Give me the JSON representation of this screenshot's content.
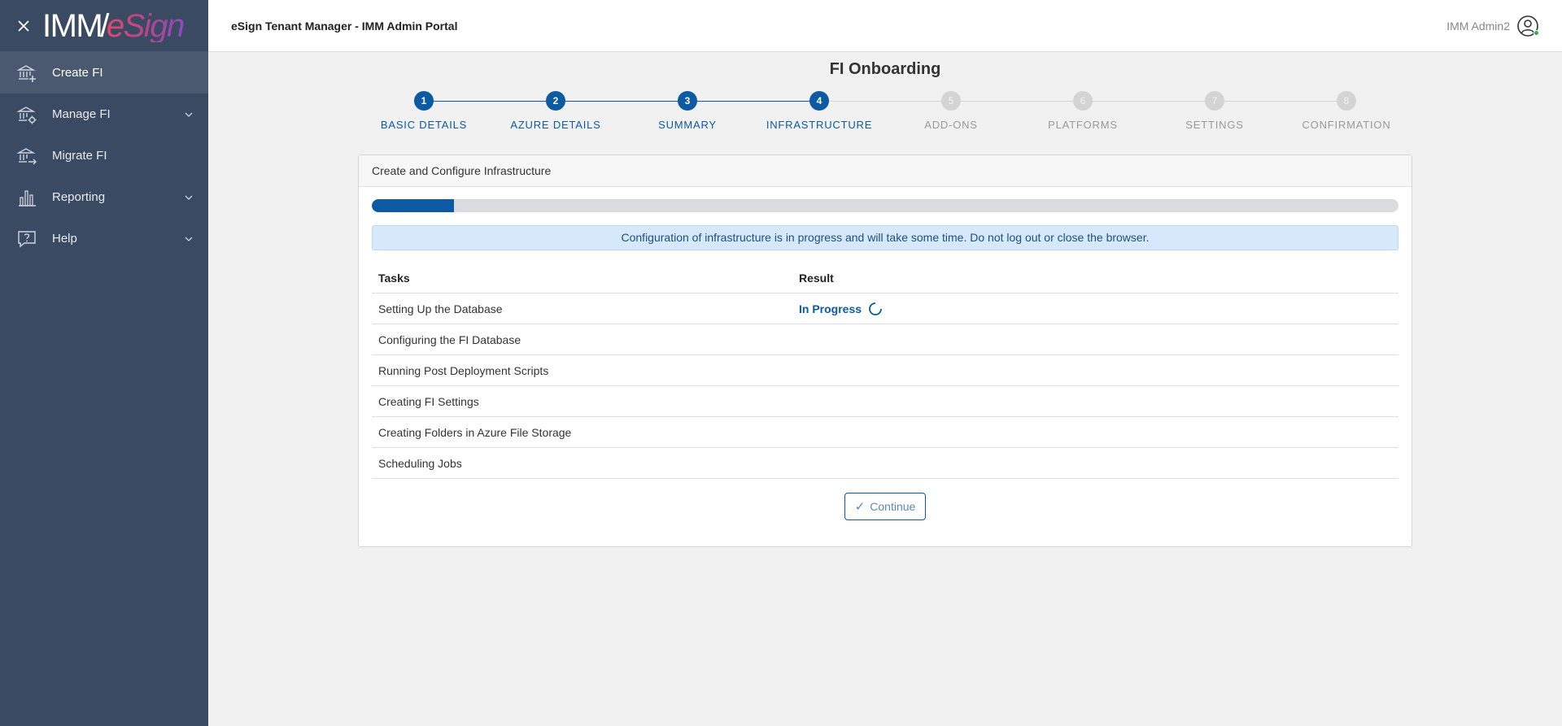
{
  "sidebar": {
    "logo": {
      "part1": "IMM",
      "part2": "/",
      "part3": "eSign"
    },
    "items": [
      {
        "label": "Create FI",
        "icon": "bank-add-icon",
        "active": true,
        "expandable": false
      },
      {
        "label": "Manage FI",
        "icon": "bank-gear-icon",
        "active": false,
        "expandable": true
      },
      {
        "label": "Migrate FI",
        "icon": "bank-arrow-icon",
        "active": false,
        "expandable": false
      },
      {
        "label": "Reporting",
        "icon": "bar-chart-icon",
        "active": false,
        "expandable": true
      },
      {
        "label": "Help",
        "icon": "help-icon",
        "active": false,
        "expandable": true
      }
    ]
  },
  "header": {
    "title": "eSign Tenant Manager - IMM Admin Portal",
    "user_name": "IMM Admin2"
  },
  "page": {
    "title": "FI Onboarding"
  },
  "stepper": {
    "current_step": 4,
    "steps": [
      {
        "number": "1",
        "label": "BASIC DETAILS"
      },
      {
        "number": "2",
        "label": "AZURE DETAILS"
      },
      {
        "number": "3",
        "label": "SUMMARY"
      },
      {
        "number": "4",
        "label": "INFRASTRUCTURE"
      },
      {
        "number": "5",
        "label": "ADD-ONS"
      },
      {
        "number": "6",
        "label": "PLATFORMS"
      },
      {
        "number": "7",
        "label": "SETTINGS"
      },
      {
        "number": "8",
        "label": "CONFIRMATION"
      }
    ]
  },
  "card": {
    "title": "Create and Configure Infrastructure",
    "progress_fraction": 0.08,
    "alert": "Configuration of infrastructure is in progress and will take some time. Do not log out or close the browser.",
    "table": {
      "headers": {
        "task": "Tasks",
        "result": "Result"
      },
      "rows": [
        {
          "task": "Setting Up the Database",
          "result": "In Progress"
        },
        {
          "task": "Configuring the FI Database",
          "result": ""
        },
        {
          "task": "Running Post Deployment Scripts",
          "result": ""
        },
        {
          "task": "Creating FI Settings",
          "result": ""
        },
        {
          "task": "Creating Folders in Azure File Storage",
          "result": ""
        },
        {
          "task": "Scheduling Jobs",
          "result": ""
        }
      ]
    },
    "continue_label": "Continue"
  },
  "colors": {
    "primary": "#0b5aa2",
    "sidebar_bg": "#3b4a63",
    "inactive_step": "#d4d4d4"
  }
}
